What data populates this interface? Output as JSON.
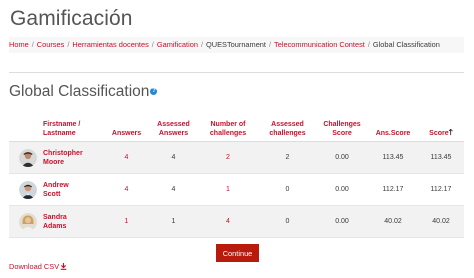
{
  "page": {
    "title": "Gamificación"
  },
  "breadcrumb": [
    {
      "label": "Home",
      "link": true
    },
    {
      "label": "Courses",
      "link": true
    },
    {
      "label": "Herramientas docentes",
      "link": true
    },
    {
      "label": "Gamification",
      "link": true
    },
    {
      "label": "QUESTournament",
      "link": false
    },
    {
      "label": "Telecommunication Contest",
      "link": true
    },
    {
      "label": "Global Classification",
      "link": false
    }
  ],
  "section": {
    "title": "Global Classification",
    "help_icon": "question-circle-icon"
  },
  "table": {
    "headers": {
      "name": "Firstname / Lastname",
      "answers": "Answers",
      "assessed_answers": "Assessed Answers",
      "num_challenges": "Number of challenges",
      "assessed_challenges": "Assessed challenges",
      "challenges_score": "Challenges Score",
      "ans_score": "Ans.Score",
      "score": "Score"
    },
    "rows": [
      {
        "firstname": "Christopher",
        "lastname": "Moore",
        "answers": "4",
        "assessed_answers": "4",
        "num_challenges": "2",
        "assessed_challenges": "2",
        "challenges_score": "0.00",
        "ans_score": "113.45",
        "score": "113.45"
      },
      {
        "firstname": "Andrew",
        "lastname": "Scott",
        "answers": "4",
        "assessed_answers": "4",
        "num_challenges": "1",
        "assessed_challenges": "0",
        "challenges_score": "0.00",
        "ans_score": "112.17",
        "score": "112.17"
      },
      {
        "firstname": "Sandra",
        "lastname": "Adams",
        "answers": "1",
        "assessed_answers": "1",
        "num_challenges": "4",
        "assessed_challenges": "0",
        "challenges_score": "0.00",
        "ans_score": "40.02",
        "score": "40.02"
      }
    ]
  },
  "actions": {
    "continue_label": "Continue",
    "download_label": "Download CSV"
  },
  "colors": {
    "accent": "#c8102e",
    "button": "#b81a0b"
  }
}
